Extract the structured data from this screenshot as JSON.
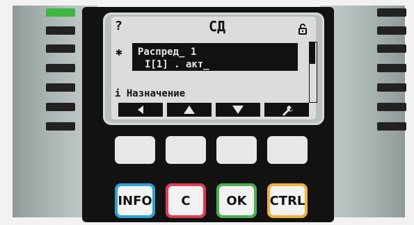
{
  "display": {
    "title": "СД",
    "help": "?",
    "star": "✱",
    "selected_item_line1": "Распред_ 1",
    "selected_item_line2": "I[1] . акт_",
    "info_label": "i Назначение"
  },
  "softkeys": {
    "back_icon": "triangle-left-icon",
    "up_icon": "triangle-up-icon",
    "down_icon": "triangle-down-icon",
    "settings_icon": "wrench-icon"
  },
  "buttons": {
    "info": "INFO",
    "c": "C",
    "ok": "OK",
    "ctrl": "CTRL"
  },
  "colors": {
    "info": "#2aa3d8",
    "c": "#e23a54",
    "ok": "#4caf50",
    "ctrl": "#f2b233",
    "led": "#3fb640"
  },
  "icons": {
    "top_right": "unlock-icon"
  },
  "scrollbar": {
    "thumb_fraction": 0.36
  }
}
